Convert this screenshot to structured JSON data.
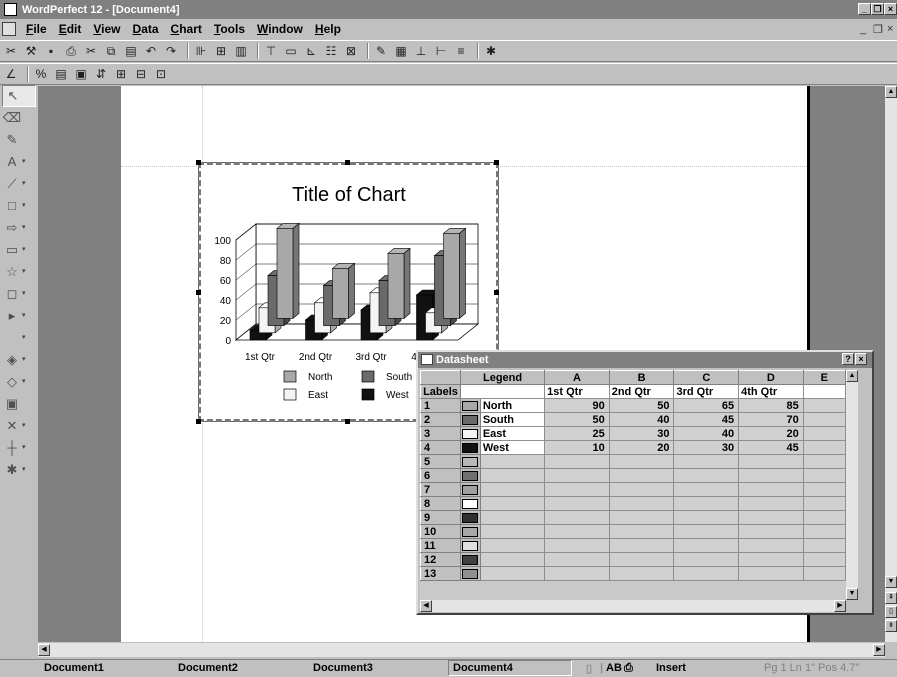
{
  "window": {
    "title": "WordPerfect 12 - [Document4]"
  },
  "menu": [
    "File",
    "Edit",
    "View",
    "Data",
    "Chart",
    "Tools",
    "Window",
    "Help"
  ],
  "chart_data": {
    "type": "bar",
    "title": "Title of Chart",
    "categories": [
      "1st Qtr",
      "2nd Qtr",
      "3rd Qtr",
      "4th Qtr"
    ],
    "series": [
      {
        "name": "North",
        "values": [
          90,
          50,
          65,
          85
        ],
        "color": "#a8a8a8"
      },
      {
        "name": "South",
        "values": [
          50,
          40,
          45,
          70
        ],
        "color": "#6a6a6a"
      },
      {
        "name": "East",
        "values": [
          25,
          30,
          40,
          20
        ],
        "color": "#f4f4f4"
      },
      {
        "name": "West",
        "values": [
          10,
          20,
          30,
          45
        ],
        "color": "#111111"
      }
    ],
    "yticks": [
      "100",
      "80",
      "60",
      "40",
      "20",
      "0"
    ],
    "ylim": [
      0,
      100
    ],
    "style": "3d",
    "legend_position": "bottom",
    "grid": true
  },
  "datasheet": {
    "title": "Datasheet",
    "labels_header": "Labels",
    "legend_header": "Legend",
    "columns": [
      "A",
      "B",
      "C",
      "D",
      "E"
    ],
    "column_labels": [
      "1st Qtr",
      "2nd Qtr",
      "3rd Qtr",
      "4th Qtr",
      ""
    ],
    "rows": [
      {
        "num": "1",
        "legend": "North",
        "values": [
          "90",
          "50",
          "65",
          "85"
        ],
        "swatch": "#a8a8a8"
      },
      {
        "num": "2",
        "legend": "South",
        "values": [
          "50",
          "40",
          "45",
          "70"
        ],
        "swatch": "#6a6a6a"
      },
      {
        "num": "3",
        "legend": "East",
        "values": [
          "25",
          "30",
          "40",
          "20"
        ],
        "swatch": "#f4f4f4"
      },
      {
        "num": "4",
        "legend": "West",
        "values": [
          "10",
          "20",
          "30",
          "45"
        ],
        "swatch": "#111111"
      },
      {
        "num": "5",
        "legend": "",
        "values": [
          "",
          "",
          "",
          ""
        ],
        "swatch": "#b8b8b8"
      },
      {
        "num": "6",
        "legend": "",
        "values": [
          "",
          "",
          "",
          ""
        ],
        "swatch": "#707070"
      },
      {
        "num": "7",
        "legend": "",
        "values": [
          "",
          "",
          "",
          ""
        ],
        "swatch": "#a0a0a0"
      },
      {
        "num": "8",
        "legend": "",
        "values": [
          "",
          "",
          "",
          ""
        ],
        "swatch": "#ffffff"
      },
      {
        "num": "9",
        "legend": "",
        "values": [
          "",
          "",
          "",
          ""
        ],
        "swatch": "#303030"
      },
      {
        "num": "10",
        "legend": "",
        "values": [
          "",
          "",
          "",
          ""
        ],
        "swatch": "#a8a8a8"
      },
      {
        "num": "11",
        "legend": "",
        "values": [
          "",
          "",
          "",
          ""
        ],
        "swatch": "#e0e0e0"
      },
      {
        "num": "12",
        "legend": "",
        "values": [
          "",
          "",
          "",
          ""
        ],
        "swatch": "#404040"
      },
      {
        "num": "13",
        "legend": "",
        "values": [
          "",
          "",
          "",
          ""
        ],
        "swatch": "#909090"
      }
    ]
  },
  "status": {
    "docs": [
      "Document1",
      "Document2",
      "Document3",
      "Document4"
    ],
    "ab": "AB",
    "mode": "Insert",
    "position": "Pg 1 Ln 1\" Pos 4.7\""
  },
  "colors": {
    "title_bar": "#808080",
    "workspace": "#808080"
  }
}
